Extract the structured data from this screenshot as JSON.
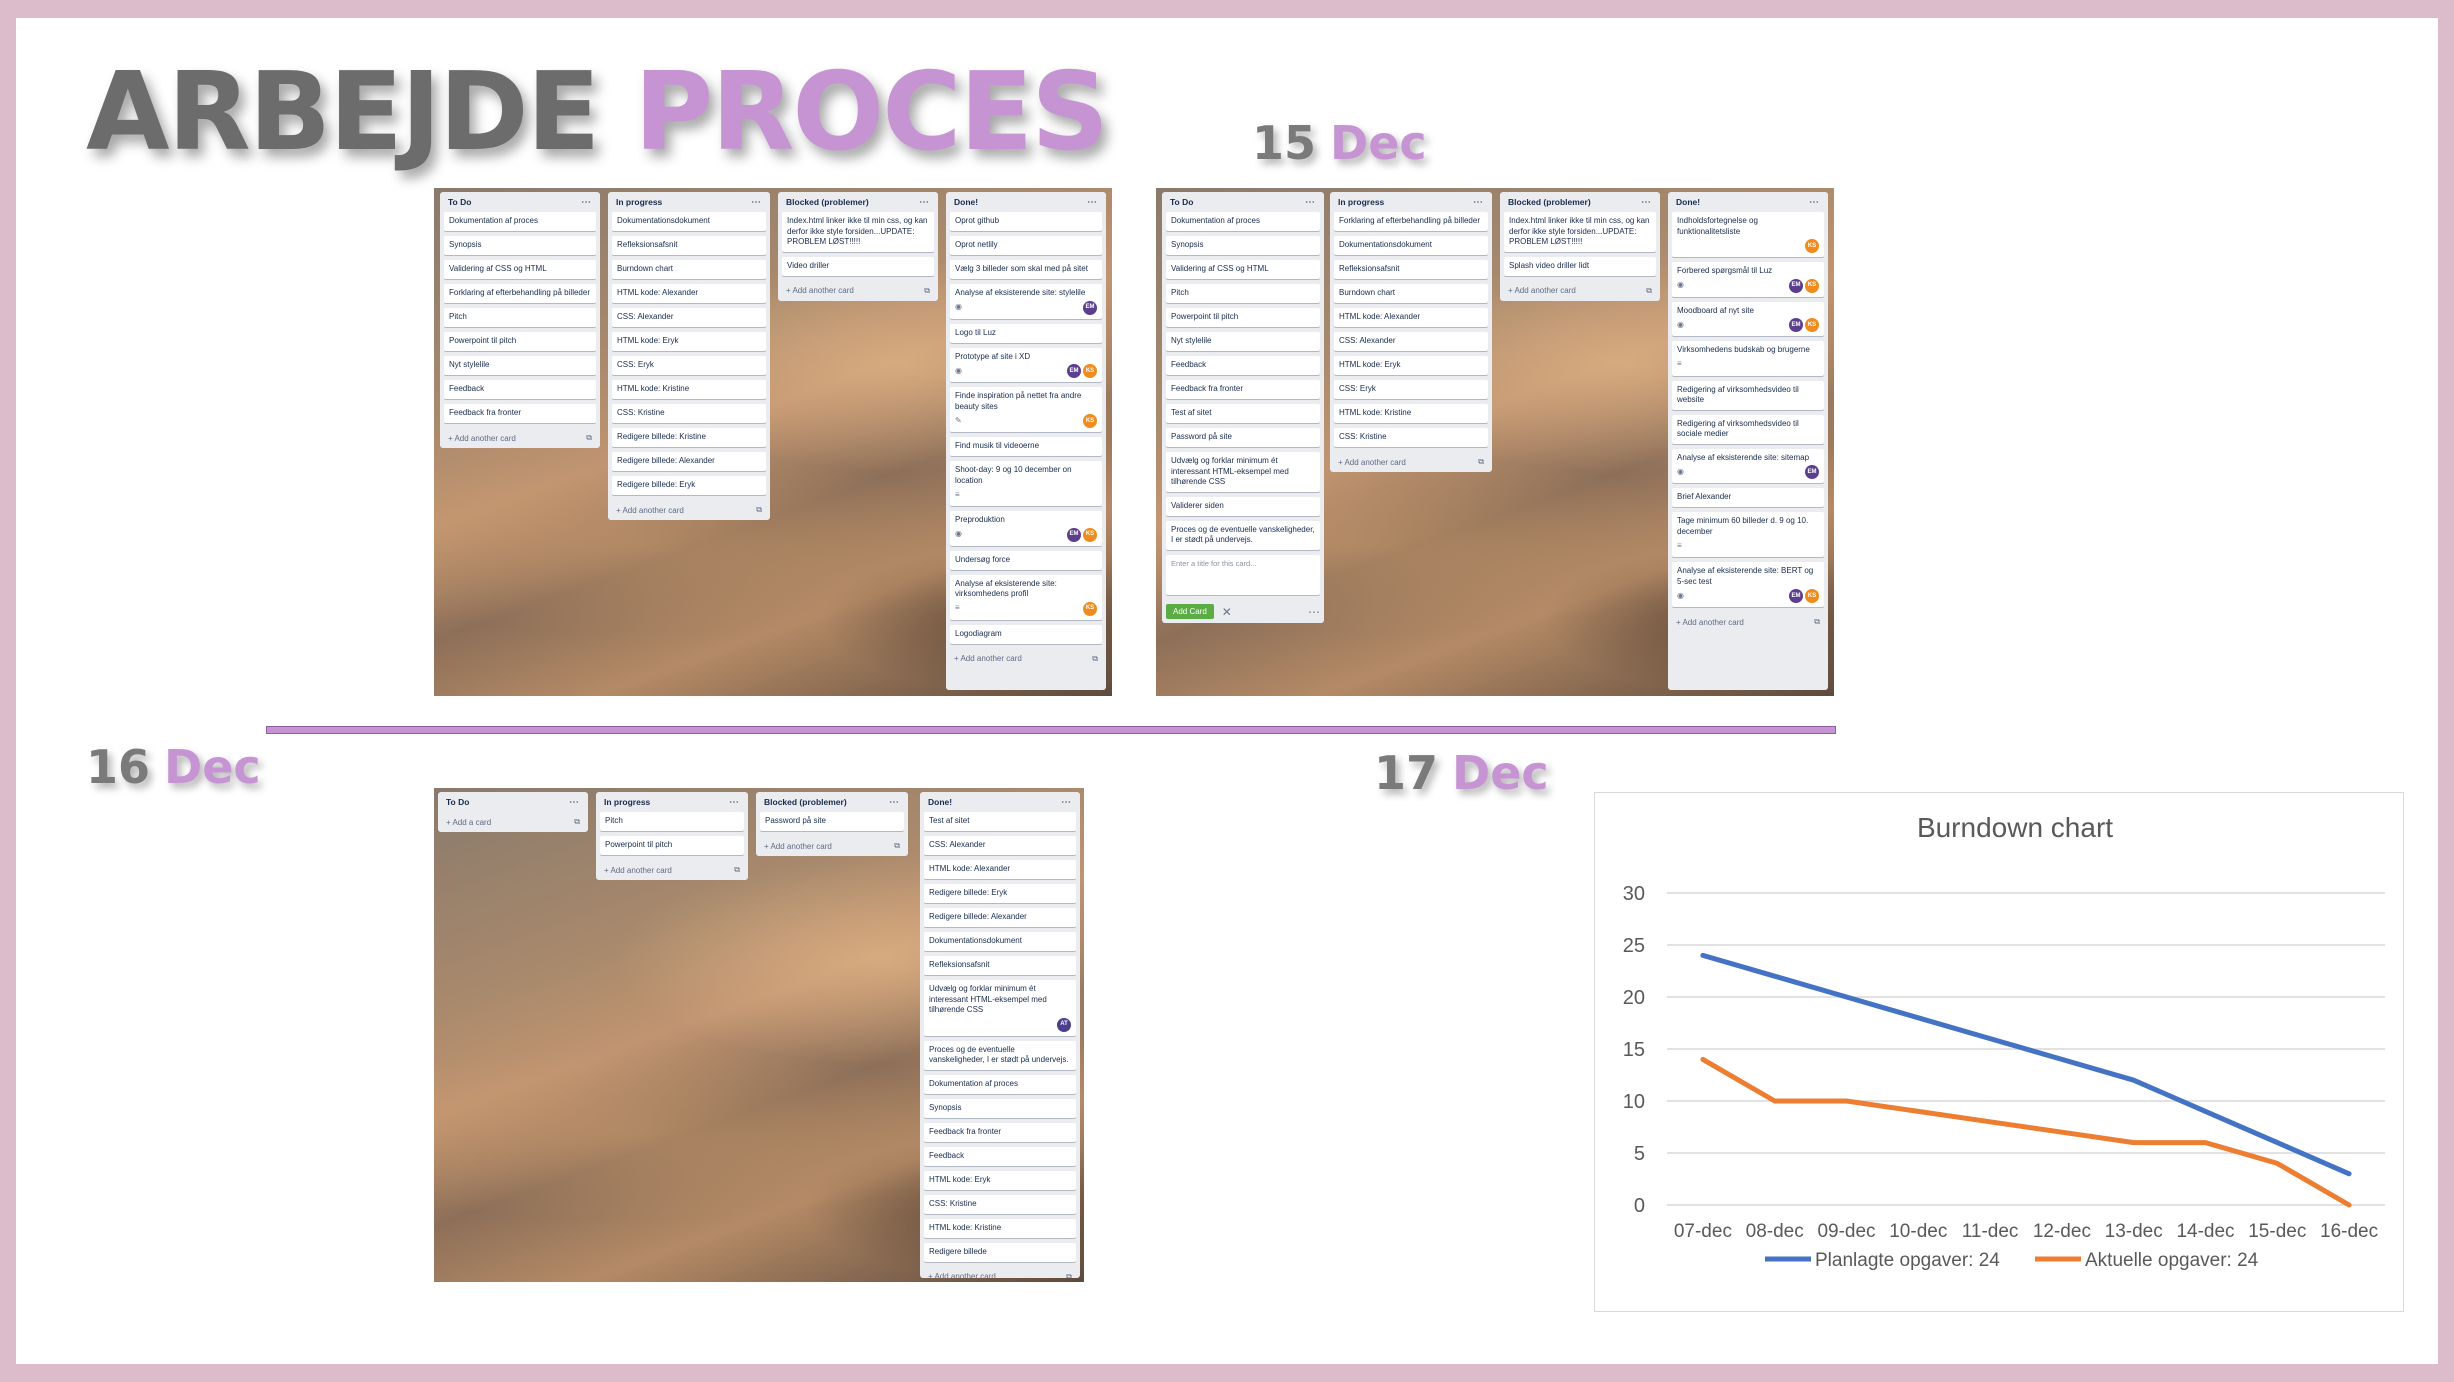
{
  "title": {
    "word1": "ARBEJDE",
    "word2": "PROCES"
  },
  "dates": [
    {
      "day": "15",
      "month": "Dec"
    },
    {
      "day": "16",
      "month": "Dec"
    },
    {
      "day": "17",
      "month": "Dec"
    }
  ],
  "board1": {
    "lists": [
      {
        "name": "To Do",
        "cards": [
          "Dokumentation af proces",
          "Synopsis",
          "Validering af CSS og HTML",
          "Forklaring af efterbehandling på billeder",
          "Pitch",
          "Powerpoint til pitch",
          "Nyt stylelile",
          "Feedback",
          "Feedback fra fronter"
        ],
        "add": "+ Add another card"
      },
      {
        "name": "In progress",
        "cards": [
          "Dokumentationsdokument",
          "Refleksionsafsnit",
          "Burndown chart",
          "HTML kode: Alexander",
          "CSS: Alexander",
          "HTML kode: Eryk",
          "CSS: Eryk",
          "HTML kode: Kristine",
          "CSS: Kristine",
          "Redigere billede: Kristine",
          "Redigere billede: Alexander",
          "Redigere billede: Eryk"
        ],
        "add": "+ Add another card"
      },
      {
        "name": "Blocked (problemer)",
        "cards": [
          "Index.html linker ikke til min css, og kan derfor ikke style forsiden...UPDATE: PROBLEM LØST!!!!!",
          "Video driller"
        ],
        "add": "+ Add another card"
      },
      {
        "name": "Done!",
        "cards": [
          "Oprot github",
          "Oprot netlily",
          "Vælg 3 billeder som skal med på sitet",
          "Analyse af eksisterende site: stylelile",
          "Logo til Luz",
          "Prototype af site i XD",
          "Finde inspiration på nettet fra andre beauty sites",
          "Find musik til videoerne",
          "Shoot-day: 9 og 10 december on location",
          "Preproduktion",
          "Undersøg force",
          "Analyse af eksisterende site: virksomhedens profil",
          "Logodiagram"
        ],
        "add": "+ Add another card"
      }
    ]
  },
  "board2": {
    "lists": [
      {
        "name": "To Do",
        "cards": [
          "Dokumentation af proces",
          "Synopsis",
          "Validering af CSS og HTML",
          "Pitch",
          "Powerpoint til pitch",
          "Nyt stylelile",
          "Feedback",
          "Feedback fra fronter",
          "Test af sitet",
          "Password på site",
          "Udvælg og forklar minimum ét interessant HTML-eksempel med tilhørende CSS",
          "Validerer siden",
          "Proces og de eventuelle vanskeligheder, I er stødt på undervejs."
        ],
        "composer_placeholder": "Enter a title for this card...",
        "add_button": "Add Card"
      },
      {
        "name": "In progress",
        "cards": [
          "Forklaring af efterbehandling på billeder",
          "Dokumentationsdokument",
          "Refleksionsafsnit",
          "Burndown chart",
          "HTML kode: Alexander",
          "CSS: Alexander",
          "HTML kode: Eryk",
          "CSS: Eryk",
          "HTML kode: Kristine",
          "CSS: Kristine"
        ],
        "add": "+ Add another card"
      },
      {
        "name": "Blocked (problemer)",
        "cards": [
          "Index.html linker ikke til min css, og kan derfor ikke style forsiden...UPDATE: PROBLEM LØST!!!!!",
          "Splash video driller lidt"
        ],
        "add": "+ Add another card"
      },
      {
        "name": "Done!",
        "cards": [
          "Indholdsfortegnelse og funktionalitetsliste",
          "Forbered spørgsmål til Luz",
          "Moodboard af nyt site",
          "Virksomhedens budskab og brugerne",
          "Redigering af virksomhedsvideo til website",
          "Redigering af virksomhedsvideo til sociale medier",
          "Analyse af eksisterende site: sitemap",
          "Brief Alexander",
          "Tage minimum 60 billeder d. 9 og 10. december",
          "Analyse af eksisterende site: BERT og 5-sec test"
        ],
        "add": "+ Add another card"
      }
    ]
  },
  "board3": {
    "lists": [
      {
        "name": "To Do",
        "cards": [],
        "add": "+ Add a card"
      },
      {
        "name": "In progress",
        "cards": [
          "Pitch",
          "Powerpoint til pitch"
        ],
        "add": "+ Add another card"
      },
      {
        "name": "Blocked (problemer)",
        "cards": [
          "Password på site"
        ],
        "add": "+ Add another card"
      },
      {
        "name": "Done!",
        "cards": [
          "Test af sitet",
          "CSS: Alexander",
          "HTML kode: Alexander",
          "Redigere billede: Eryk",
          "Redigere billede: Alexander",
          "Dokumentationsdokument",
          "Refleksionsafsnit",
          "Udvælg og forklar minimum ét interessant HTML-eksempel med tilhørende CSS",
          "Proces og de eventuelle vanskeligheder, I er stødt på undervejs.",
          "Dokumentation af proces",
          "Synopsis",
          "Feedback fra fronter",
          "Feedback",
          "HTML kode: Eryk",
          "CSS: Kristine",
          "HTML kode: Kristine",
          "Redigere billede"
        ],
        "add": "+ Add another card"
      }
    ]
  },
  "icons": {
    "menu": "⋯",
    "template": "⧉",
    "badge": "≡",
    "eye": "◉",
    "edit": "✎",
    "close": "✕"
  },
  "avatar_labels": {
    "em": "EM",
    "ks": "KS",
    "at": "AT"
  },
  "colors": {
    "planned": "#4472c4",
    "actual": "#ed7d31",
    "accent": "#c694d3"
  },
  "chart_data": {
    "type": "line",
    "title": "Burndown chart",
    "categories": [
      "07-dec",
      "08-dec",
      "09-dec",
      "10-dec",
      "11-dec",
      "12-dec",
      "13-dec",
      "14-dec",
      "15-dec",
      "16-dec"
    ],
    "series": [
      {
        "name": "Planlagte opgaver: 24",
        "values": [
          24,
          22,
          20,
          18,
          16,
          14,
          12,
          9,
          6,
          3
        ]
      },
      {
        "name": "Aktuelle opgaver: 24",
        "values": [
          14,
          10,
          10,
          9,
          8,
          7,
          6,
          6,
          4,
          0
        ]
      }
    ],
    "yticks": [
      0,
      5,
      10,
      15,
      20,
      25,
      30
    ],
    "ylim": [
      0,
      30
    ],
    "grid": true,
    "legend": "bottom"
  }
}
